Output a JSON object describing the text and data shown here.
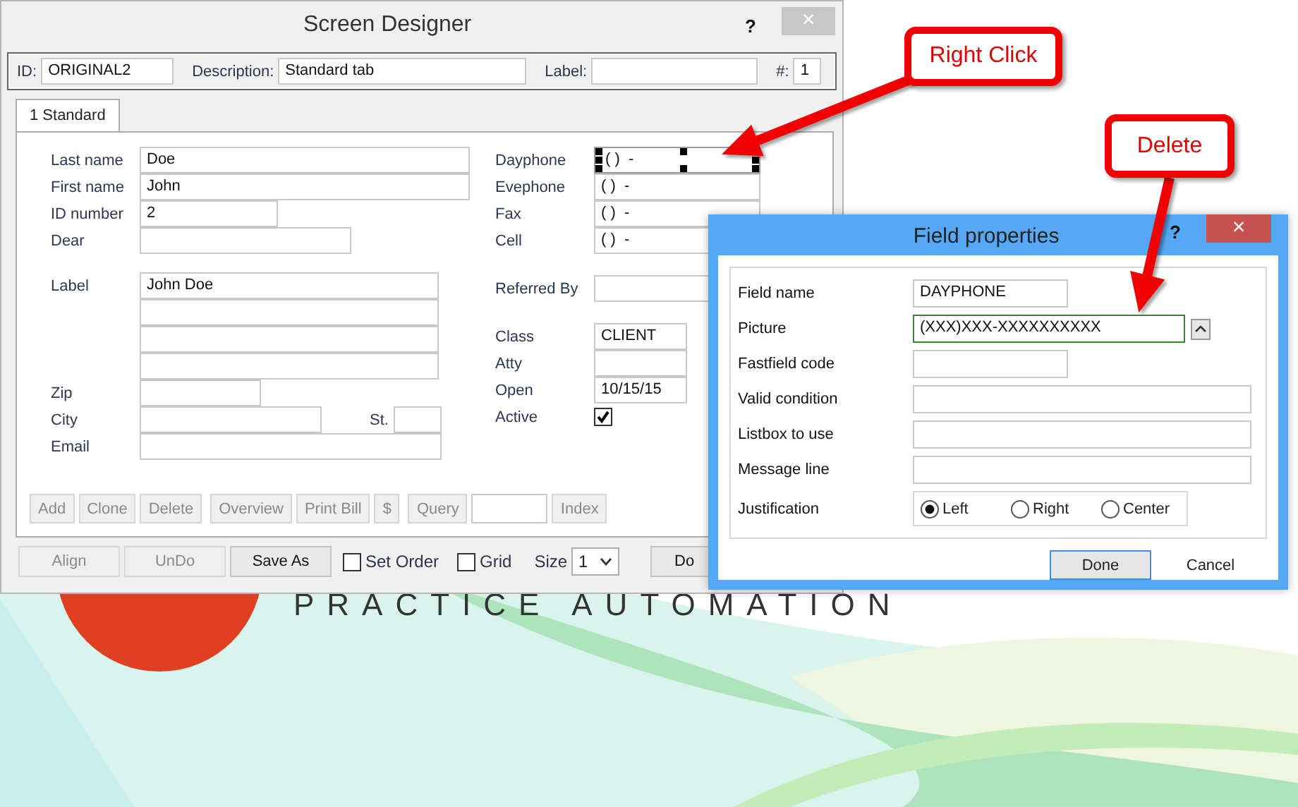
{
  "screen_designer": {
    "title": "Screen Designer",
    "help": "?",
    "close": "×",
    "header_fields": [
      {
        "label": "ID:",
        "value": "ORIGINAL2"
      },
      {
        "label": "Description:",
        "value": "Standard tab"
      },
      {
        "label": "Label:"
      },
      {
        "label": "#:",
        "value": "1"
      }
    ],
    "tabs": [
      {
        "label": "1 Standard",
        "selected": true
      }
    ],
    "left_fields": [
      {
        "label": "Last name",
        "value": "Doe"
      },
      {
        "label": "First name",
        "value": "John"
      },
      {
        "label": "ID number",
        "value": "2"
      },
      {
        "label": "Dear"
      }
    ],
    "label_field": {
      "label": "Label",
      "value": "John Doe"
    },
    "address_fields": [
      {
        "label": "Zip"
      },
      {
        "label": "City"
      },
      {
        "label": "St."
      },
      {
        "label": "Email"
      }
    ],
    "phone_fields": [
      {
        "label": "Dayphone",
        "value": "( )  -",
        "selected": true
      },
      {
        "label": "Evephone",
        "value": "( )  -",
        "selected": false
      },
      {
        "label": "Fax",
        "value": "( )  -",
        "selected": false
      },
      {
        "label": "Cell",
        "value": "( )  -",
        "selected": false
      }
    ],
    "referred_by": {
      "label": "Referred By"
    },
    "status_fields": [
      {
        "label": "Class",
        "value": "CLIENT"
      },
      {
        "label": "Atty"
      },
      {
        "label": "Open",
        "value": "10/15/15"
      }
    ],
    "active": {
      "label": "Active",
      "checked": true
    },
    "button_groups": [
      [
        {
          "kind": "button",
          "label": "Add",
          "disabled": true
        },
        {
          "kind": "button",
          "label": "Clone",
          "disabled": true
        },
        {
          "kind": "button",
          "label": "Delete",
          "disabled": true
        }
      ],
      [
        {
          "kind": "button",
          "label": "Overview",
          "disabled": true
        },
        {
          "kind": "button",
          "label": "Print Bill",
          "disabled": true
        },
        {
          "kind": "button",
          "label": "$",
          "disabled": true
        }
      ],
      [
        {
          "kind": "button",
          "label": "Query",
          "disabled": true
        },
        {
          "kind": "field"
        },
        {
          "kind": "button",
          "label": "Index",
          "disabled": true
        }
      ]
    ],
    "designer_buttons": [
      {
        "label": "Align",
        "disabled": true
      },
      {
        "label": "UnDo",
        "disabled": true
      },
      {
        "label": "Save As",
        "disabled": false
      }
    ],
    "options": [
      {
        "label": "Set Order",
        "checked": false
      },
      {
        "label": "Grid",
        "checked": false
      }
    ],
    "size": {
      "label": "Size",
      "value": "1"
    },
    "done_button": {
      "label": "Do"
    }
  },
  "field_properties": {
    "title": "Field properties",
    "help": "?",
    "close": "×",
    "fields": [
      {
        "label": "Field name",
        "value": "DAYPHONE",
        "focused": false
      },
      {
        "label": "Picture",
        "value": "(XXX)XXX-XXXXXXXXXX",
        "focused": true
      },
      {
        "label": "Fastfield code",
        "focused": false
      },
      {
        "label": "Valid condition",
        "focused": false
      },
      {
        "label": "Listbox to use",
        "focused": false
      },
      {
        "label": "Message line",
        "focused": false
      }
    ],
    "justification": {
      "label": "Justification",
      "options": [
        {
          "label": "Left",
          "selected": true
        },
        {
          "label": "Right",
          "selected": false
        },
        {
          "label": "Center",
          "selected": false
        }
      ]
    },
    "buttons": [
      {
        "label": "Done",
        "default": true
      },
      {
        "label": "Cancel",
        "default": false
      }
    ]
  },
  "callouts": [
    {
      "text": "Right Click"
    },
    {
      "text": "Delete"
    }
  ],
  "background": {
    "tagline": "PRACTICE AUTOMATION"
  }
}
